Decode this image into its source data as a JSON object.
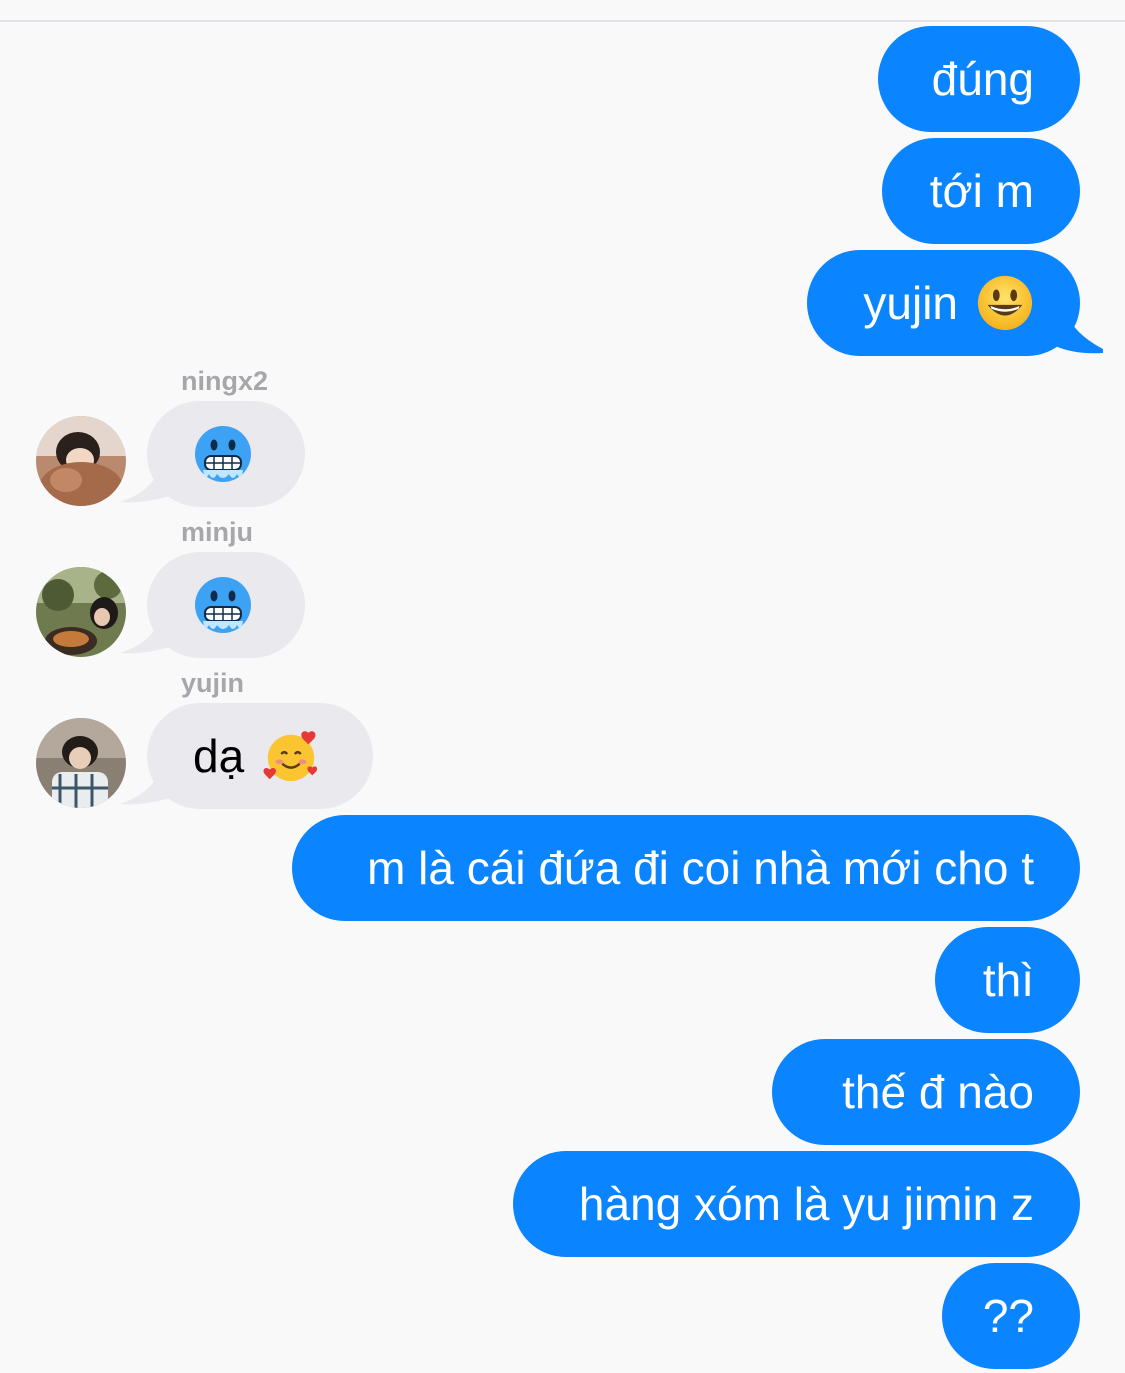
{
  "messages_sent_1": [
    "đúng",
    "tới m",
    "yujin"
  ],
  "emoji_sent": "grinning-face",
  "incoming": [
    {
      "sender": "ningx2",
      "emoji": "cold-face"
    },
    {
      "sender": "minju",
      "emoji": "cold-face"
    },
    {
      "sender": "yujin",
      "text": "dạ",
      "emoji": "smiling-face-with-hearts"
    }
  ],
  "messages_sent_2": [
    "m là cái đứa đi coi nhà mới cho t",
    "thì",
    "thế đ nào",
    "hàng xóm là yu jimin z",
    "??"
  ],
  "colors": {
    "outgoing_bubble": "#0a84ff",
    "incoming_bubble": "#e9e9ee",
    "background": "#f9f9fa",
    "sender_name": "#a7a7ab"
  }
}
